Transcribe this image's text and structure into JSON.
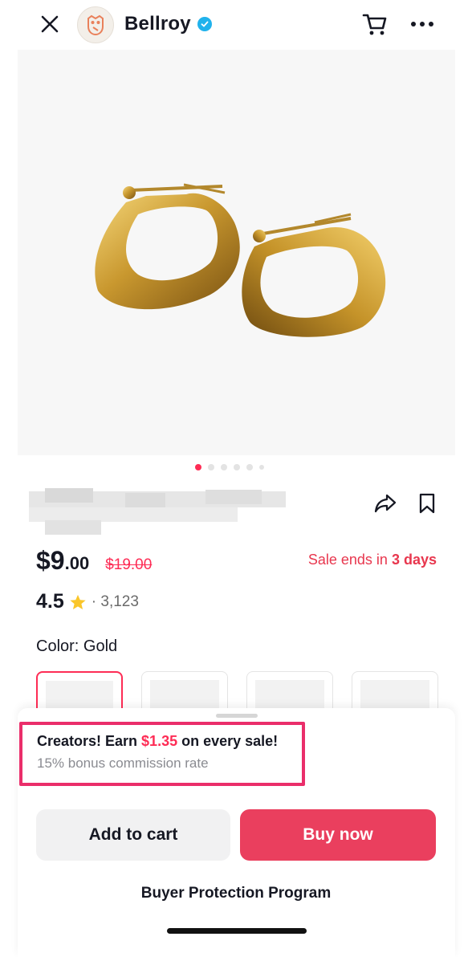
{
  "header": {
    "brand": "Bellroy",
    "icons": [
      "close-icon",
      "owl-logo",
      "verified-icon",
      "cart-icon",
      "more-icon"
    ]
  },
  "gallery": {
    "pages": 6,
    "current": 1
  },
  "product": {
    "price_main": "$9",
    "price_cents": ".00",
    "price_original": "$19.00",
    "sale_prefix": "Sale ends in ",
    "sale_days": "3 days",
    "rating": "4.5",
    "rating_count": "· 3,123",
    "color_label": "Color: Gold"
  },
  "promo": {
    "line1_prefix": "Creators! Earn ",
    "line1_amount": "$1.35",
    "line1_suffix": " on every sale!",
    "line2": "15% bonus commission rate"
  },
  "actions": {
    "add_to_cart": "Add to cart",
    "buy_now": "Buy now",
    "protection": "Buyer Protection Program"
  },
  "colors": {
    "accent": "#fe2c55",
    "buy_button": "#ea3f5e",
    "verified": "#20b2ec"
  }
}
